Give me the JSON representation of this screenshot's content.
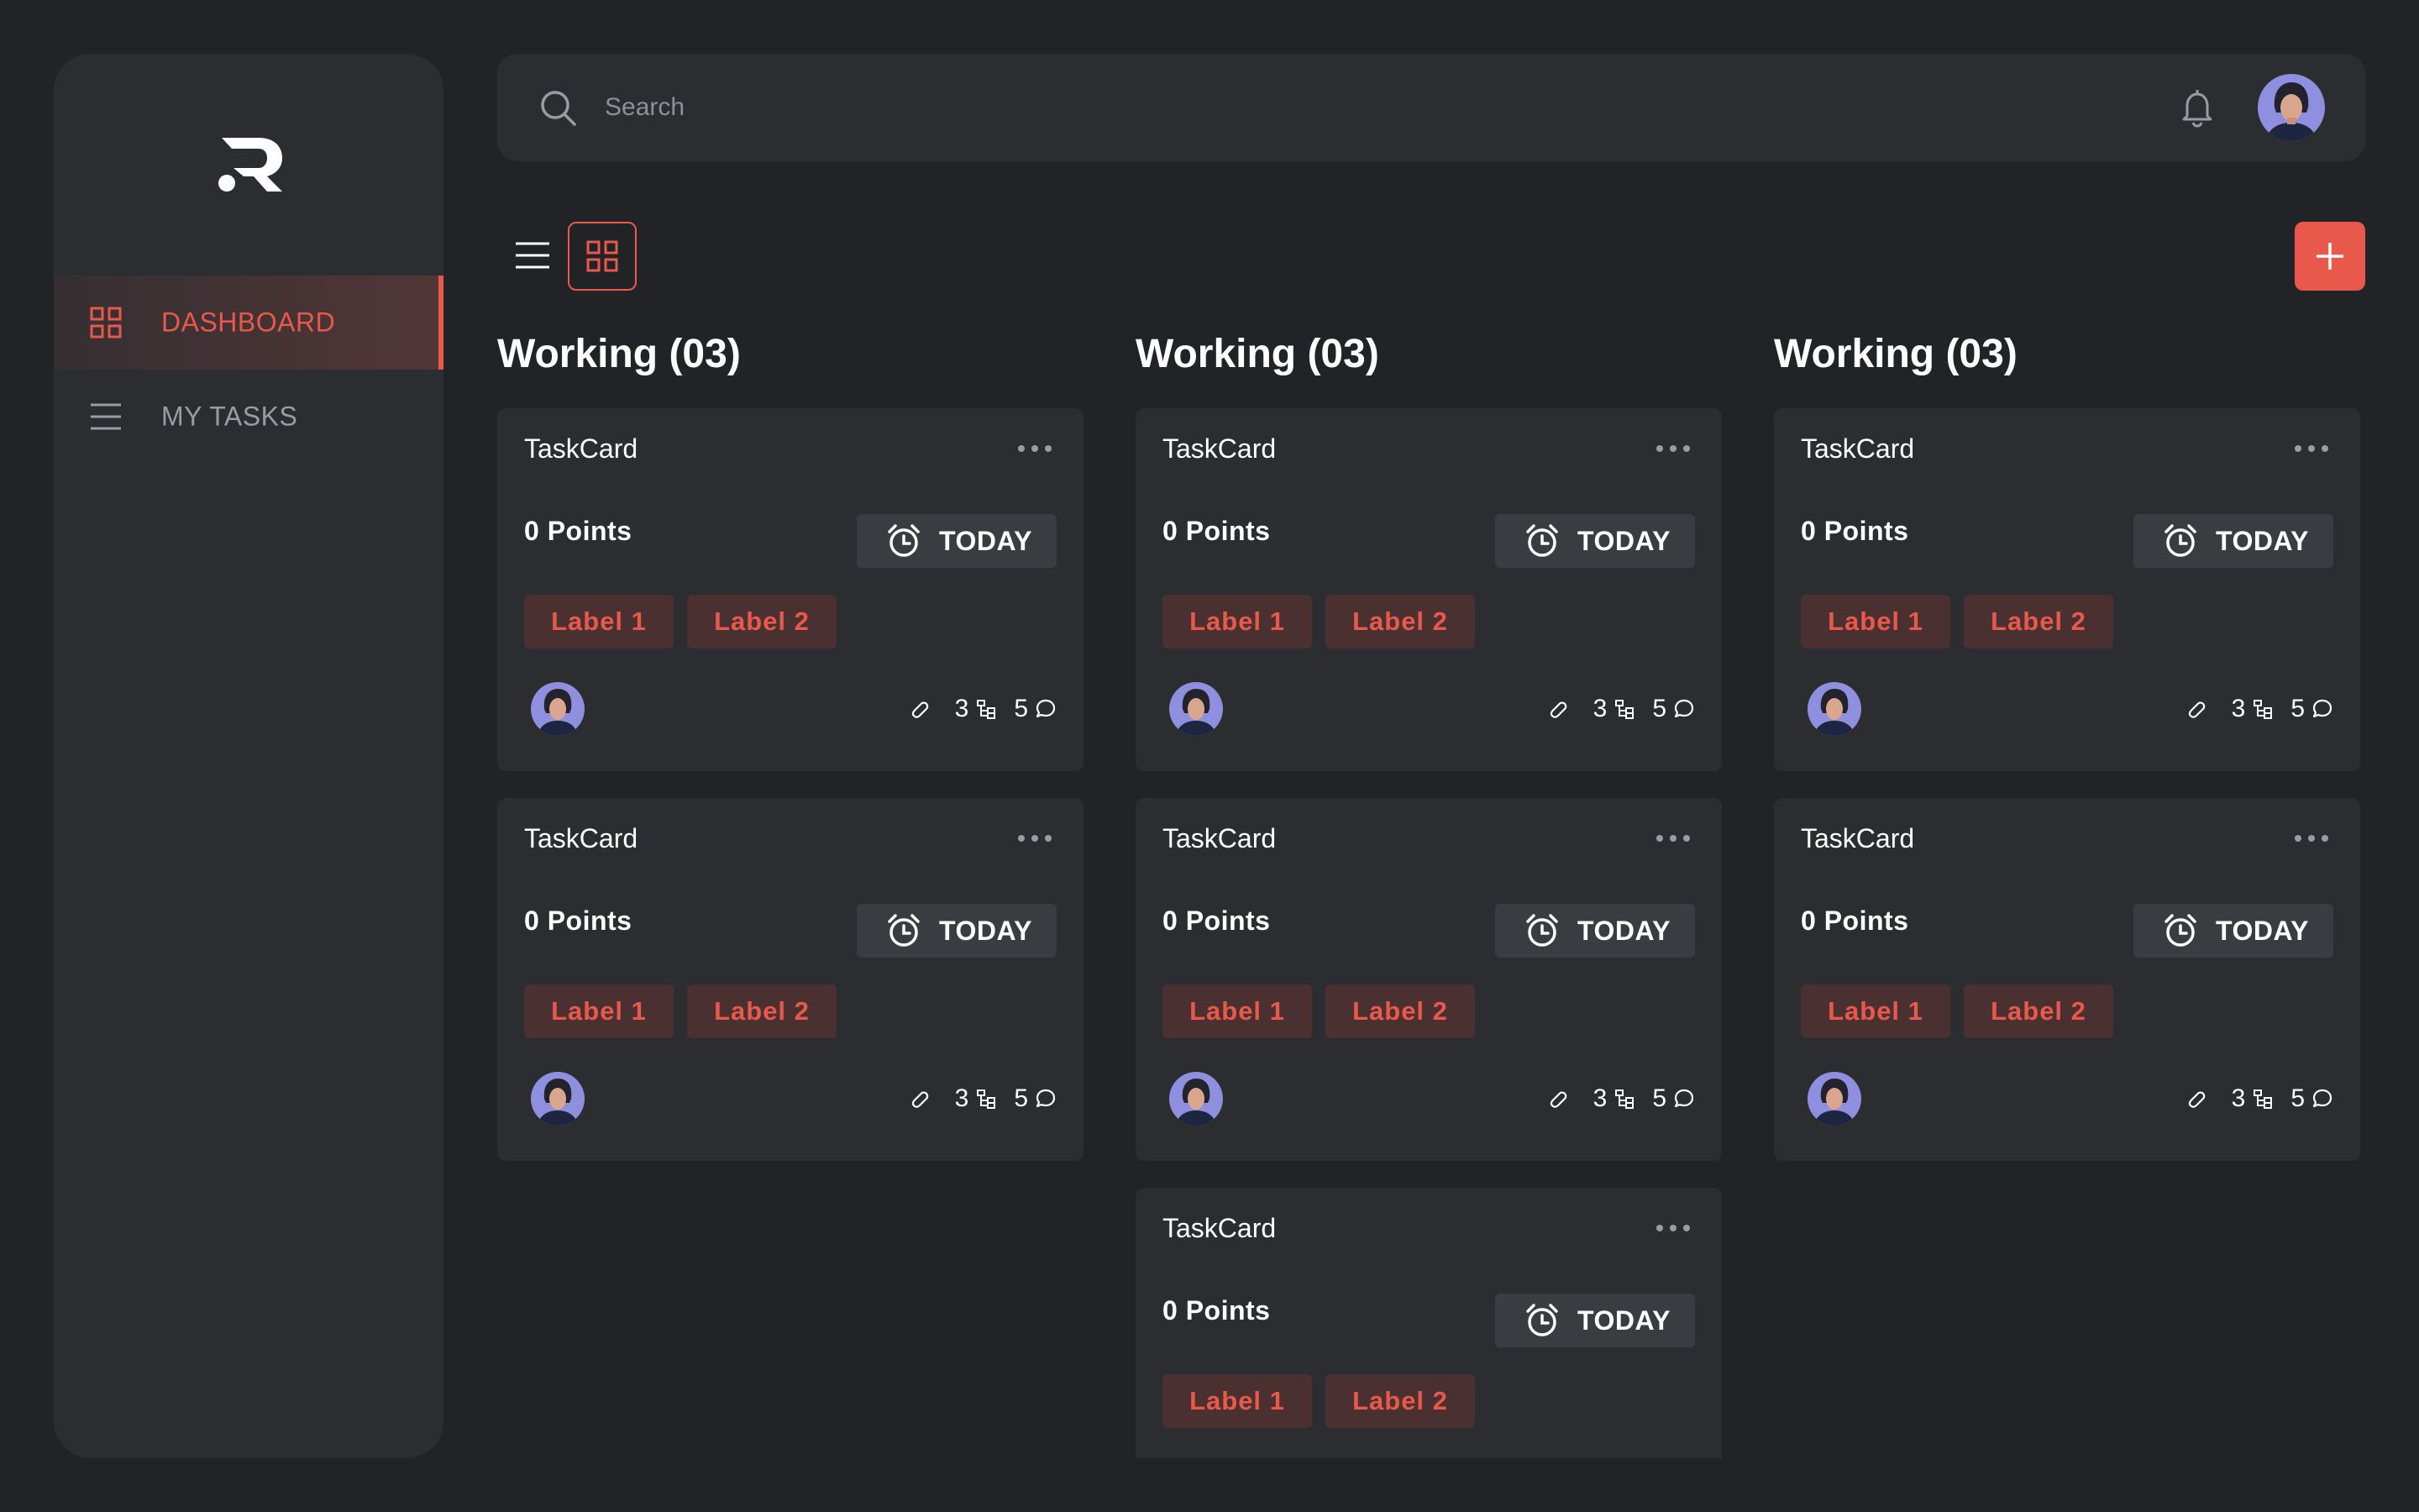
{
  "app": {
    "logo": "R",
    "accent_color": "#e8594c",
    "background": "#212327",
    "panel": "#2b2d31"
  },
  "sidebar": {
    "items": [
      {
        "label": "DASHBOARD",
        "icon": "grid-icon",
        "active": true
      },
      {
        "label": "MY TASKS",
        "icon": "menu-icon",
        "active": false
      }
    ]
  },
  "header": {
    "search_placeholder": "Search",
    "search_value": "",
    "icons": [
      "search-icon",
      "bell-icon",
      "avatar"
    ]
  },
  "toolbar": {
    "views": [
      "list-view-icon",
      "grid-view-icon"
    ],
    "active_view": "grid",
    "add_label": "+"
  },
  "columns": [
    {
      "title": "Working (03)",
      "cards": [
        {
          "title": "TaskCard",
          "points": "0 Points",
          "due": "TODAY",
          "labels": [
            "Label 1",
            "Label 2"
          ],
          "subtasks": "3",
          "comments": "5"
        },
        {
          "title": "TaskCard",
          "points": "0 Points",
          "due": "TODAY",
          "labels": [
            "Label 1",
            "Label 2"
          ],
          "subtasks": "3",
          "comments": "5"
        }
      ]
    },
    {
      "title": "Working (03)",
      "cards": [
        {
          "title": "TaskCard",
          "points": "0 Points",
          "due": "TODAY",
          "labels": [
            "Label 1",
            "Label 2"
          ],
          "subtasks": "3",
          "comments": "5"
        },
        {
          "title": "TaskCard",
          "points": "0 Points",
          "due": "TODAY",
          "labels": [
            "Label 1",
            "Label 2"
          ],
          "subtasks": "3",
          "comments": "5"
        },
        {
          "title": "TaskCard",
          "points": "0 Points",
          "due": "TODAY",
          "labels": [
            "Label 1",
            "Label 2"
          ]
        }
      ]
    },
    {
      "title": "Working (03)",
      "cards": [
        {
          "title": "TaskCard",
          "points": "0 Points",
          "due": "TODAY",
          "labels": [
            "Label 1",
            "Label 2"
          ],
          "subtasks": "3",
          "comments": "5"
        },
        {
          "title": "TaskCard",
          "points": "0 Points",
          "due": "TODAY",
          "labels": [
            "Label 1",
            "Label 2"
          ],
          "subtasks": "3",
          "comments": "5"
        }
      ]
    }
  ]
}
